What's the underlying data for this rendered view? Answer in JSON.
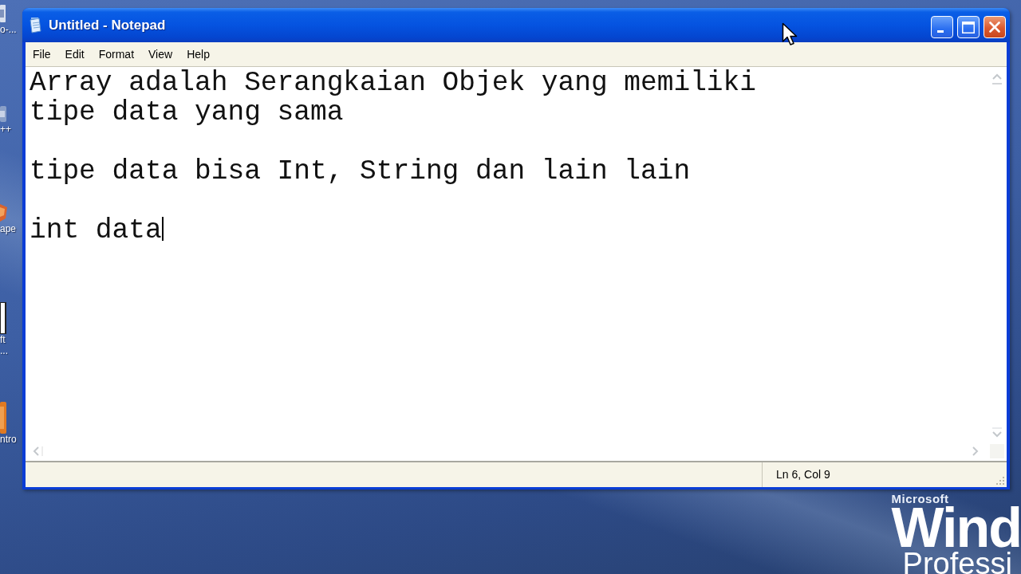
{
  "desktop": {
    "icons": [
      {
        "label_lines": [
          "o-..."
        ]
      },
      {
        "label_lines": [
          "++"
        ]
      },
      {
        "label_lines": [
          "ape"
        ]
      },
      {
        "label_lines": [
          "ft",
          "..."
        ]
      },
      {
        "label_lines": [
          "ntro"
        ]
      }
    ],
    "logo": {
      "brand": "Microsoft",
      "wordmark": "Wind",
      "edition": "Professi"
    }
  },
  "window": {
    "title": "Untitled - Notepad",
    "controls": [
      {
        "kind": "minimize"
      },
      {
        "kind": "maximize"
      },
      {
        "kind": "close"
      }
    ]
  },
  "menu": [
    {
      "label": "File"
    },
    {
      "label": "Edit"
    },
    {
      "label": "Format"
    },
    {
      "label": "View"
    },
    {
      "label": "Help"
    }
  ],
  "editor": {
    "value": "Array adalah Serangkaian Objek yang memiliki\ntipe data yang sama\n\ntipe data bisa Int, String dan lain lain\n\nint data",
    "cursor": true
  },
  "status_bar": {
    "position": "Ln 6, Col 9"
  }
}
